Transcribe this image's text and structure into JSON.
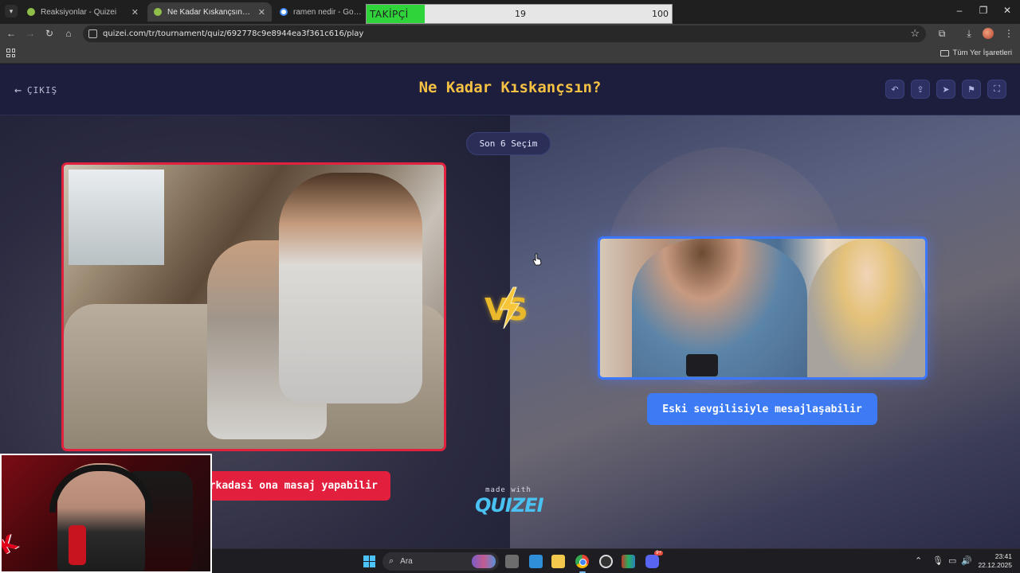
{
  "browser": {
    "tabs": [
      {
        "label": "Reaksiyonlar - Quizei",
        "active": false,
        "favicon_color": "#8fbf4a"
      },
      {
        "label": "Ne Kadar Kıskançsın? - Tier List",
        "active": true,
        "favicon_color": "#8fbf4a"
      },
      {
        "label": "ramen nedir - Google'da A",
        "active": false,
        "favicon_color": "#4285f4"
      }
    ],
    "url": "quizei.com/tr/tournament/quiz/692778c9e8944ea3f361c616/play",
    "bookmarks_all_label": "Tüm Yer İşaretleri"
  },
  "follower_widget": {
    "label": "TAKİPÇİ",
    "count": "19",
    "goal": "100",
    "progress": 0.19
  },
  "app": {
    "exit_label": "ÇIKIŞ",
    "title": "Ne Kadar Kıskançsın?",
    "header_icons": [
      "undo-icon",
      "share-icon",
      "send-icon",
      "flag-icon",
      "fullscreen-icon"
    ],
    "round_badge": "Son 6 Seçim",
    "vs_label": "VS",
    "left_option": {
      "caption": "...in arkadasi ona masaj yapabilir",
      "border_color": "#e0223f"
    },
    "right_option": {
      "caption": "Eski sevgilisiyle mesajlaşabilir",
      "border_color": "#3c78ff"
    },
    "made_with": "made with",
    "brand": "QUIZEI"
  },
  "taskbar": {
    "search_placeholder": "Ara",
    "time": "23:41",
    "date": "22.12.2025",
    "notification_badge": "9+"
  },
  "colors": {
    "accent_title": "#f5c244",
    "left_accent": "#e21f3d",
    "right_accent": "#3d7bf4",
    "brand": "#49c2f2"
  }
}
